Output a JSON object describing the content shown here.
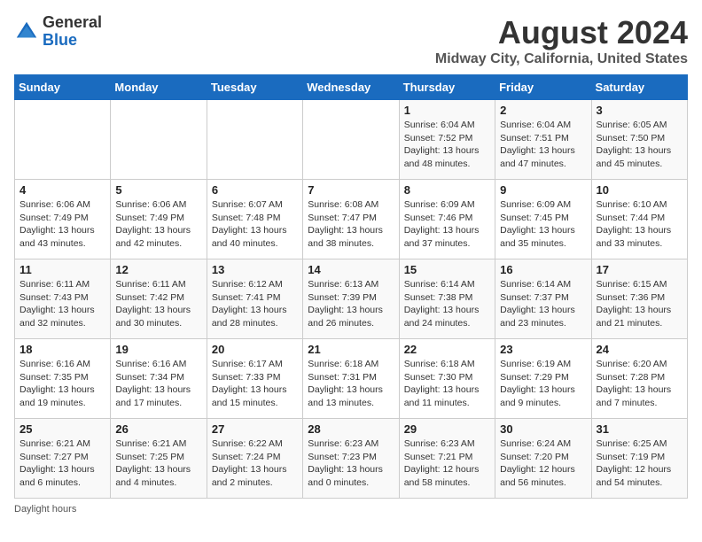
{
  "header": {
    "logo_general": "General",
    "logo_blue": "Blue",
    "month_title": "August 2024",
    "location": "Midway City, California, United States"
  },
  "days_of_week": [
    "Sunday",
    "Monday",
    "Tuesday",
    "Wednesday",
    "Thursday",
    "Friday",
    "Saturday"
  ],
  "weeks": [
    [
      {
        "day": "",
        "sunrise": "",
        "sunset": "",
        "daylight": ""
      },
      {
        "day": "",
        "sunrise": "",
        "sunset": "",
        "daylight": ""
      },
      {
        "day": "",
        "sunrise": "",
        "sunset": "",
        "daylight": ""
      },
      {
        "day": "",
        "sunrise": "",
        "sunset": "",
        "daylight": ""
      },
      {
        "day": "1",
        "sunrise": "Sunrise: 6:04 AM",
        "sunset": "Sunset: 7:52 PM",
        "daylight": "Daylight: 13 hours and 48 minutes."
      },
      {
        "day": "2",
        "sunrise": "Sunrise: 6:04 AM",
        "sunset": "Sunset: 7:51 PM",
        "daylight": "Daylight: 13 hours and 47 minutes."
      },
      {
        "day": "3",
        "sunrise": "Sunrise: 6:05 AM",
        "sunset": "Sunset: 7:50 PM",
        "daylight": "Daylight: 13 hours and 45 minutes."
      }
    ],
    [
      {
        "day": "4",
        "sunrise": "Sunrise: 6:06 AM",
        "sunset": "Sunset: 7:49 PM",
        "daylight": "Daylight: 13 hours and 43 minutes."
      },
      {
        "day": "5",
        "sunrise": "Sunrise: 6:06 AM",
        "sunset": "Sunset: 7:49 PM",
        "daylight": "Daylight: 13 hours and 42 minutes."
      },
      {
        "day": "6",
        "sunrise": "Sunrise: 6:07 AM",
        "sunset": "Sunset: 7:48 PM",
        "daylight": "Daylight: 13 hours and 40 minutes."
      },
      {
        "day": "7",
        "sunrise": "Sunrise: 6:08 AM",
        "sunset": "Sunset: 7:47 PM",
        "daylight": "Daylight: 13 hours and 38 minutes."
      },
      {
        "day": "8",
        "sunrise": "Sunrise: 6:09 AM",
        "sunset": "Sunset: 7:46 PM",
        "daylight": "Daylight: 13 hours and 37 minutes."
      },
      {
        "day": "9",
        "sunrise": "Sunrise: 6:09 AM",
        "sunset": "Sunset: 7:45 PM",
        "daylight": "Daylight: 13 hours and 35 minutes."
      },
      {
        "day": "10",
        "sunrise": "Sunrise: 6:10 AM",
        "sunset": "Sunset: 7:44 PM",
        "daylight": "Daylight: 13 hours and 33 minutes."
      }
    ],
    [
      {
        "day": "11",
        "sunrise": "Sunrise: 6:11 AM",
        "sunset": "Sunset: 7:43 PM",
        "daylight": "Daylight: 13 hours and 32 minutes."
      },
      {
        "day": "12",
        "sunrise": "Sunrise: 6:11 AM",
        "sunset": "Sunset: 7:42 PM",
        "daylight": "Daylight: 13 hours and 30 minutes."
      },
      {
        "day": "13",
        "sunrise": "Sunrise: 6:12 AM",
        "sunset": "Sunset: 7:41 PM",
        "daylight": "Daylight: 13 hours and 28 minutes."
      },
      {
        "day": "14",
        "sunrise": "Sunrise: 6:13 AM",
        "sunset": "Sunset: 7:39 PM",
        "daylight": "Daylight: 13 hours and 26 minutes."
      },
      {
        "day": "15",
        "sunrise": "Sunrise: 6:14 AM",
        "sunset": "Sunset: 7:38 PM",
        "daylight": "Daylight: 13 hours and 24 minutes."
      },
      {
        "day": "16",
        "sunrise": "Sunrise: 6:14 AM",
        "sunset": "Sunset: 7:37 PM",
        "daylight": "Daylight: 13 hours and 23 minutes."
      },
      {
        "day": "17",
        "sunrise": "Sunrise: 6:15 AM",
        "sunset": "Sunset: 7:36 PM",
        "daylight": "Daylight: 13 hours and 21 minutes."
      }
    ],
    [
      {
        "day": "18",
        "sunrise": "Sunrise: 6:16 AM",
        "sunset": "Sunset: 7:35 PM",
        "daylight": "Daylight: 13 hours and 19 minutes."
      },
      {
        "day": "19",
        "sunrise": "Sunrise: 6:16 AM",
        "sunset": "Sunset: 7:34 PM",
        "daylight": "Daylight: 13 hours and 17 minutes."
      },
      {
        "day": "20",
        "sunrise": "Sunrise: 6:17 AM",
        "sunset": "Sunset: 7:33 PM",
        "daylight": "Daylight: 13 hours and 15 minutes."
      },
      {
        "day": "21",
        "sunrise": "Sunrise: 6:18 AM",
        "sunset": "Sunset: 7:31 PM",
        "daylight": "Daylight: 13 hours and 13 minutes."
      },
      {
        "day": "22",
        "sunrise": "Sunrise: 6:18 AM",
        "sunset": "Sunset: 7:30 PM",
        "daylight": "Daylight: 13 hours and 11 minutes."
      },
      {
        "day": "23",
        "sunrise": "Sunrise: 6:19 AM",
        "sunset": "Sunset: 7:29 PM",
        "daylight": "Daylight: 13 hours and 9 minutes."
      },
      {
        "day": "24",
        "sunrise": "Sunrise: 6:20 AM",
        "sunset": "Sunset: 7:28 PM",
        "daylight": "Daylight: 13 hours and 7 minutes."
      }
    ],
    [
      {
        "day": "25",
        "sunrise": "Sunrise: 6:21 AM",
        "sunset": "Sunset: 7:27 PM",
        "daylight": "Daylight: 13 hours and 6 minutes."
      },
      {
        "day": "26",
        "sunrise": "Sunrise: 6:21 AM",
        "sunset": "Sunset: 7:25 PM",
        "daylight": "Daylight: 13 hours and 4 minutes."
      },
      {
        "day": "27",
        "sunrise": "Sunrise: 6:22 AM",
        "sunset": "Sunset: 7:24 PM",
        "daylight": "Daylight: 13 hours and 2 minutes."
      },
      {
        "day": "28",
        "sunrise": "Sunrise: 6:23 AM",
        "sunset": "Sunset: 7:23 PM",
        "daylight": "Daylight: 13 hours and 0 minutes."
      },
      {
        "day": "29",
        "sunrise": "Sunrise: 6:23 AM",
        "sunset": "Sunset: 7:21 PM",
        "daylight": "Daylight: 12 hours and 58 minutes."
      },
      {
        "day": "30",
        "sunrise": "Sunrise: 6:24 AM",
        "sunset": "Sunset: 7:20 PM",
        "daylight": "Daylight: 12 hours and 56 minutes."
      },
      {
        "day": "31",
        "sunrise": "Sunrise: 6:25 AM",
        "sunset": "Sunset: 7:19 PM",
        "daylight": "Daylight: 12 hours and 54 minutes."
      }
    ]
  ],
  "footer": {
    "note": "Daylight hours"
  }
}
